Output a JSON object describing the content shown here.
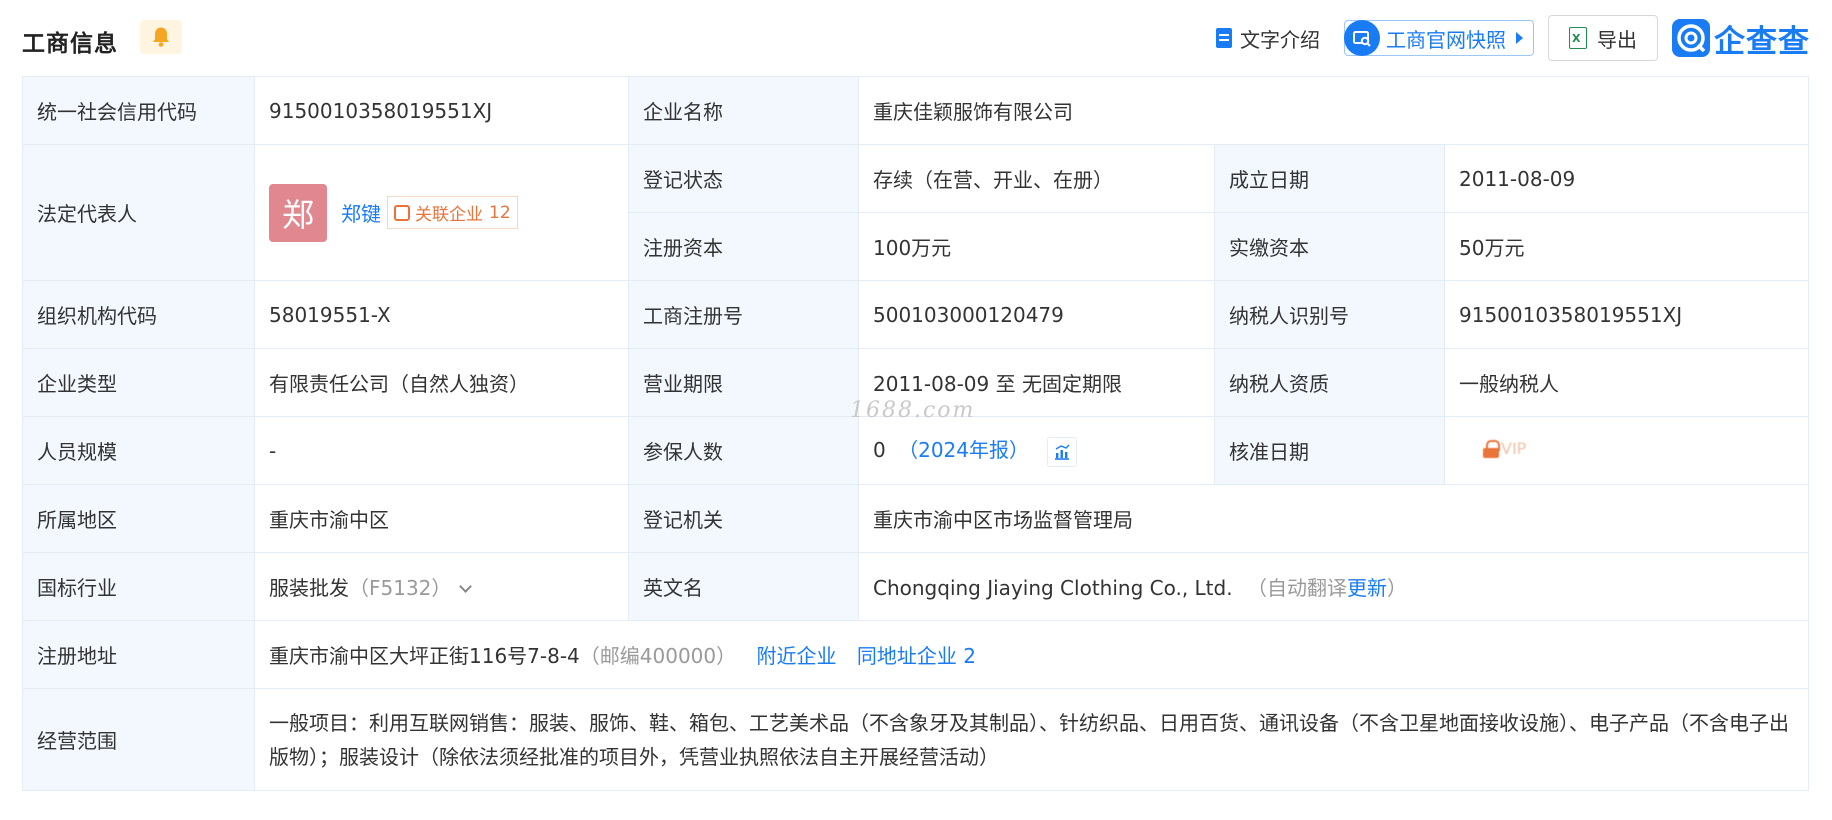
{
  "header": {
    "title": "工商信息",
    "intro_label": "文字介绍",
    "snapshot_label": "工商官网快照",
    "export_label": "导出",
    "logo_text": "企查查"
  },
  "rows": {
    "credit_code": {
      "label": "统一社会信用代码",
      "value": "9150010358019551XJ"
    },
    "company_name": {
      "label": "企业名称",
      "value": "重庆佳颖服饰有限公司"
    },
    "legal_rep": {
      "label": "法定代表人",
      "avatar_char": "郑",
      "name": "郑键",
      "related_label": "关联企业",
      "related_count": "12"
    },
    "reg_status": {
      "label": "登记状态",
      "value": "存续（在营、开业、在册）"
    },
    "found_date": {
      "label": "成立日期",
      "value": "2011-08-09"
    },
    "reg_capital": {
      "label": "注册资本",
      "value": "100万元"
    },
    "paid_capital": {
      "label": "实缴资本",
      "value": "50万元"
    },
    "org_code": {
      "label": "组织机构代码",
      "value": "58019551-X"
    },
    "biz_reg_no": {
      "label": "工商注册号",
      "value": "500103000120479"
    },
    "taxpayer_id": {
      "label": "纳税人识别号",
      "value": "9150010358019551XJ"
    },
    "company_type": {
      "label": "企业类型",
      "value": "有限责任公司（自然人独资）"
    },
    "biz_term": {
      "label": "营业期限",
      "value": "2011-08-09 至 无固定期限"
    },
    "taxpayer_qual": {
      "label": "纳税人资质",
      "value": "一般纳税人"
    },
    "staff_size": {
      "label": "人员规模",
      "value": "-"
    },
    "insured": {
      "label": "参保人数",
      "value": "0",
      "report": "（2024年报）"
    },
    "approve_date": {
      "label": "核准日期",
      "vip_text": "VIP"
    },
    "region": {
      "label": "所属地区",
      "value": "重庆市渝中区"
    },
    "reg_authority": {
      "label": "登记机关",
      "value": "重庆市渝中区市场监督管理局"
    },
    "industry": {
      "label": "国标行业",
      "value": "服装批发",
      "code": "（F5132）"
    },
    "english_name": {
      "label": "英文名",
      "value": "Chongqing Jiaying Clothing Co., Ltd.",
      "auto_prefix": "（自动翻译",
      "update_link": "更新",
      "auto_suffix": "）"
    },
    "reg_address": {
      "label": "注册地址",
      "value": "重庆市渝中区大坪正街116号7-8-4",
      "postcode": "（邮编400000）",
      "nearby_link": "附近企业",
      "same_addr_link": "同地址企业",
      "same_addr_count": "2"
    },
    "biz_scope": {
      "label": "经营范围",
      "value": "一般项目：利用互联网销售：服装、服饰、鞋、箱包、工艺美术品（不含象牙及其制品）、针纺织品、日用百货、通讯设备（不含卫星地面接收设施）、电子产品（不含电子出版物）；服装设计（除依法须经批准的项目外，凭营业执照依法自主开展经营活动）"
    }
  },
  "watermark": "1688.com",
  "colors": {
    "accent": "#1a7cf5",
    "label_bg": "#f2f8fe",
    "border": "#e4ecf6",
    "orange": "#e8743b",
    "avatar": "#e0878f"
  },
  "icons": [
    "bell-icon",
    "document-icon",
    "snapshot-icon",
    "excel-icon",
    "qichacha-logo-icon",
    "related-company-icon",
    "trend-chart-icon",
    "lock-icon",
    "chevron-down-icon"
  ]
}
